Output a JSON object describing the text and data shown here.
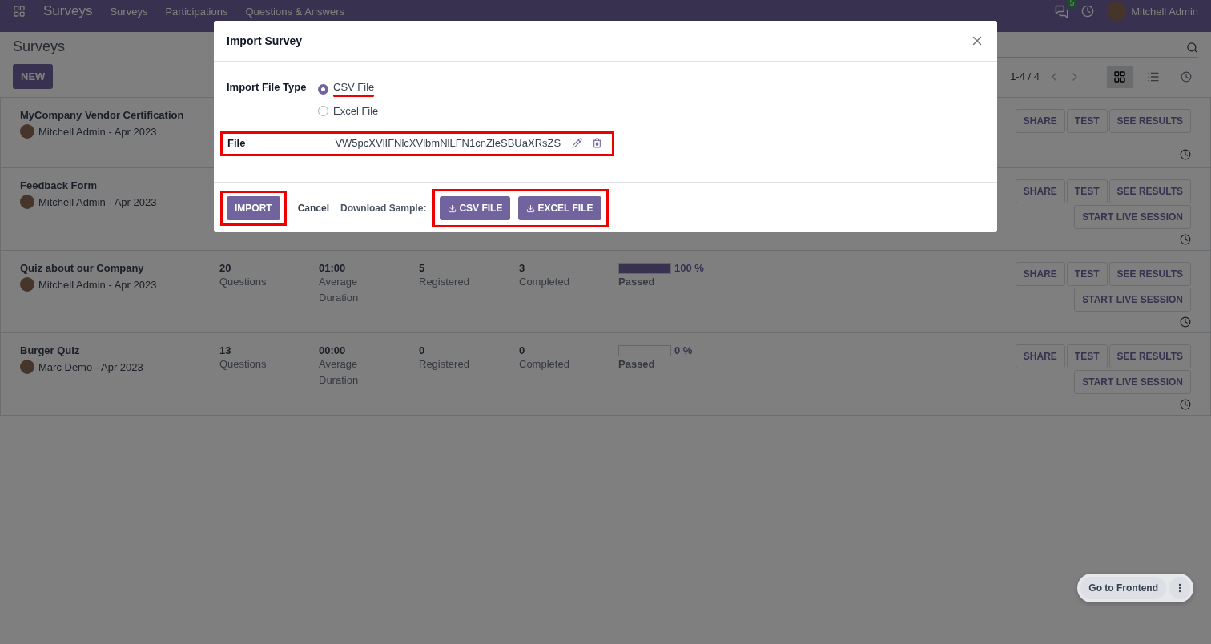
{
  "navbar": {
    "app_name": "Surveys",
    "menu": [
      "Surveys",
      "Participations",
      "Questions & Answers"
    ],
    "messages_count": "5",
    "user": "Mitchell Admin"
  },
  "control_panel": {
    "title": "Surveys",
    "new_button": "NEW",
    "pager": "1-4 / 4",
    "views": [
      {
        "kind": "kanban",
        "selected": true
      },
      {
        "kind": "list",
        "selected": false
      },
      {
        "kind": "activity",
        "selected": false
      }
    ]
  },
  "surveys": [
    {
      "title": "MyCompany Vendor Certification",
      "author": "Mitchell Admin - Apr 2023",
      "buttons": [
        "SHARE",
        "TEST",
        "SEE RESULTS"
      ]
    },
    {
      "title": "Feedback Form",
      "author": "Mitchell Admin - Apr 2023",
      "buttons": [
        "SHARE",
        "TEST",
        "SEE RESULTS"
      ],
      "live_session": "START LIVE SESSION"
    },
    {
      "title": "Quiz about our Company",
      "author": "Mitchell Admin - Apr 2023",
      "stats": [
        {
          "value": "20",
          "label": "Questions"
        },
        {
          "value": "01:00",
          "label": "Average Duration"
        },
        {
          "value": "5",
          "label": "Registered"
        },
        {
          "value": "3",
          "label": "Completed"
        }
      ],
      "passed": {
        "level": 1,
        "percent": "100 %",
        "label": "Passed"
      },
      "buttons": [
        "SHARE",
        "TEST",
        "SEE RESULTS"
      ],
      "live_session": "START LIVE SESSION"
    },
    {
      "title": "Burger Quiz",
      "author": "Marc Demo - Apr 2023",
      "stats": [
        {
          "value": "13",
          "label": "Questions"
        },
        {
          "value": "00:00",
          "label": "Average Duration"
        },
        {
          "value": "0",
          "label": "Registered"
        },
        {
          "value": "0",
          "label": "Completed"
        }
      ],
      "passed": {
        "level": 0,
        "percent": "0 %",
        "label": "Passed"
      },
      "buttons": [
        "SHARE",
        "TEST",
        "SEE RESULTS"
      ],
      "live_session": "START LIVE SESSION"
    }
  ],
  "modal": {
    "title": "Import Survey",
    "file_type_label": "Import File Type",
    "options": [
      {
        "label": "CSV File",
        "selected": true
      },
      {
        "label": "Excel File",
        "selected": false
      }
    ],
    "file_label": "File",
    "file_value": "VW5pcXVlIFNlcXVlbmNlLFN1cnZleSBUaXRsZS",
    "import_button": "IMPORT",
    "cancel_button": "Cancel",
    "download_label": "Download Sample:",
    "samples": [
      "CSV FILE",
      "EXCEL FILE"
    ]
  },
  "floating": {
    "label": "Go to Frontend"
  }
}
